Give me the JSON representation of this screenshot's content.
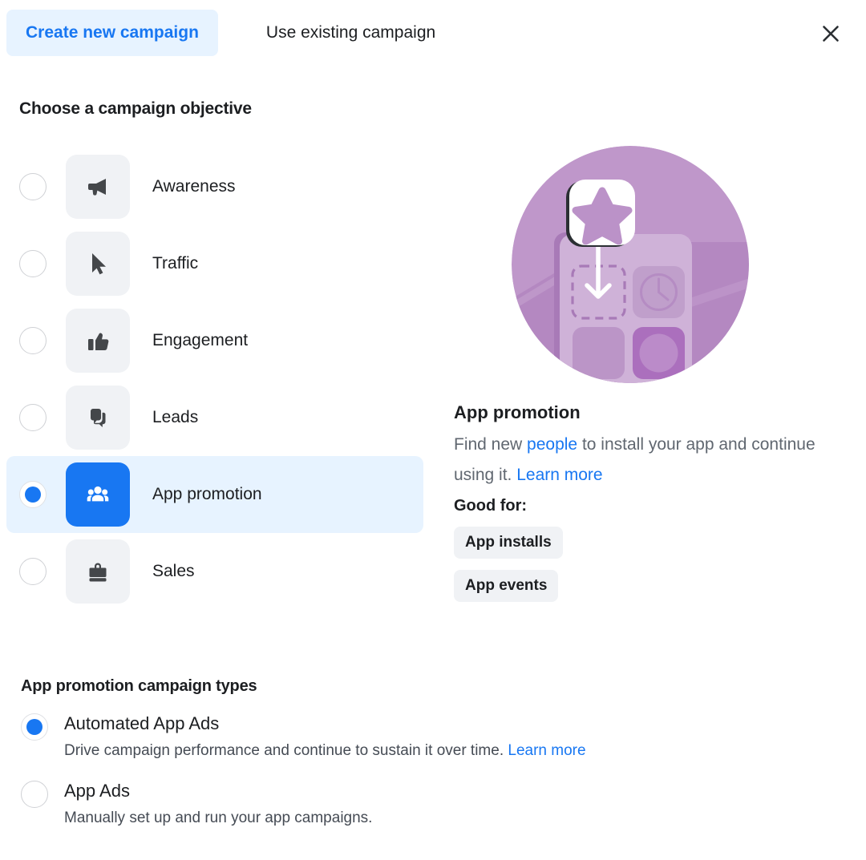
{
  "header": {
    "tabs": [
      {
        "label": "Create new campaign",
        "active": true
      },
      {
        "label": "Use existing campaign",
        "active": false
      }
    ],
    "close_label": "✕"
  },
  "objective_section": {
    "heading": "Choose a campaign objective",
    "items": [
      {
        "label": "Awareness",
        "icon": "megaphone-icon",
        "selected": false
      },
      {
        "label": "Traffic",
        "icon": "cursor-icon",
        "selected": false
      },
      {
        "label": "Engagement",
        "icon": "thumbs-up-icon",
        "selected": false
      },
      {
        "label": "Leads",
        "icon": "chat-bubbles-icon",
        "selected": false
      },
      {
        "label": "App promotion",
        "icon": "people-group-icon",
        "selected": true
      },
      {
        "label": "Sales",
        "icon": "briefcase-icon",
        "selected": false
      }
    ]
  },
  "detail": {
    "illustration": "app-promotion-illustration",
    "title": "App promotion",
    "desc_part1": "Find new ",
    "desc_link1": "people",
    "desc_part2": " to install your app and continue using it. ",
    "desc_link2": "Learn more",
    "good_for_label": "Good for:",
    "chips": [
      "App installs",
      "App events"
    ]
  },
  "campaign_types": {
    "heading": "App promotion campaign types",
    "options": [
      {
        "title": "Automated App Ads",
        "desc": "Drive campaign performance and continue to sustain it over time. ",
        "link": "Learn more",
        "selected": true
      },
      {
        "title": "App Ads",
        "desc": "Manually set up and run your app campaigns.",
        "link": "",
        "selected": false
      }
    ]
  },
  "colors": {
    "accent_blue": "#1877f2",
    "tab_active_bg": "#e7f3ff",
    "icon_tile_bg": "#f0f2f5",
    "selected_row_bg": "#e7f3ff",
    "illustration_purple": "#b98fc4",
    "text_primary": "#1c1e21",
    "text_secondary": "#606770"
  }
}
